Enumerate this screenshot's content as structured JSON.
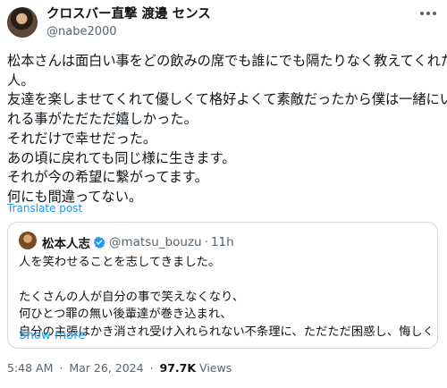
{
  "author": {
    "display_name": "クロスバー直撃 渡邊 センス",
    "handle": "@nabe2000"
  },
  "tweet": {
    "lines": [
      "松本さんは面白い事をどの飲みの席でも誰にでも隔たりなく教えてくれた",
      "人。",
      "友達を楽しませてくれて優しくて格好よくて素敵だったから僕は一緒にい",
      "れる事がただただ嬉しかった。",
      "それだけで幸せだった。",
      "あの頃に戻れても同じ様に生きます。",
      "それが今の希望に繋がってます。",
      "何にも間違ってない。"
    ],
    "translate_label": "Translate post"
  },
  "quote": {
    "name": "松本人志",
    "handle": "@matsu_bouzu",
    "separator": "·",
    "time": "11h",
    "lines": [
      "人を笑わせることを志してきました。",
      "",
      "たくさんの人が自分の事で笑えなくなり、",
      "何ひとつ罪の無い後輩達が巻き込まれ、",
      "自分の主張はかき消され受け入れられない不条理に、ただただ困惑し、悔しく..."
    ],
    "show_more": "Show more",
    "verified_color": "#1d9bf0"
  },
  "footer": {
    "time": "5:48 AM",
    "separator": "·",
    "date": "Mar 26, 2024",
    "views_count": "97.7K",
    "views_label": "Views"
  }
}
